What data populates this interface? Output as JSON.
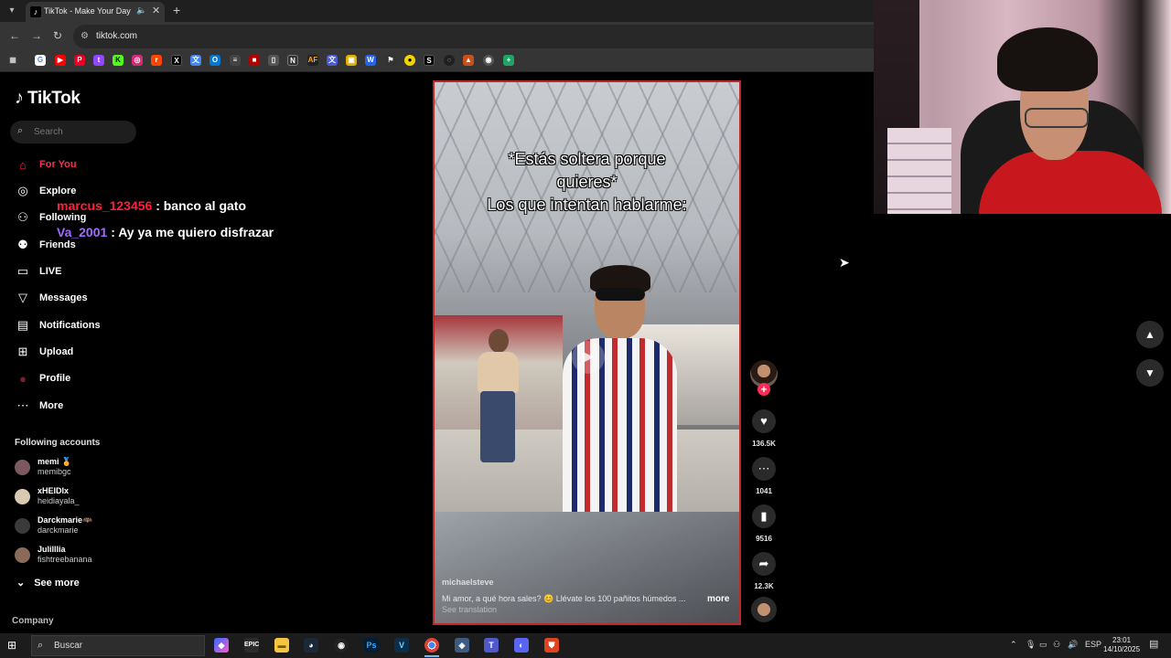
{
  "browser": {
    "tab_title": "TikTok - Make Your Day",
    "url": "tiktok.com",
    "tab_close": "✕",
    "new_tab": "+"
  },
  "tiktok": {
    "logo": "TikTok",
    "search_placeholder": "Search",
    "nav": [
      {
        "label": "For You",
        "icon": "home-icon",
        "active": true
      },
      {
        "label": "Explore",
        "icon": "compass-icon"
      },
      {
        "label": "Following",
        "icon": "following-icon"
      },
      {
        "label": "Friends",
        "icon": "friends-icon"
      },
      {
        "label": "LIVE",
        "icon": "live-icon"
      },
      {
        "label": "Messages",
        "icon": "messages-icon"
      },
      {
        "label": "Notifications",
        "icon": "notifications-icon"
      },
      {
        "label": "Upload",
        "icon": "upload-icon"
      },
      {
        "label": "Profile",
        "icon": "profile-icon"
      },
      {
        "label": "More",
        "icon": "more-icon"
      }
    ],
    "following_header": "Following accounts",
    "accounts": [
      {
        "name": "memi 🏅",
        "handle": "memibgc"
      },
      {
        "name": "xHEIDIx",
        "handle": "heidiayala_"
      },
      {
        "name": "Darckmarie🦇",
        "handle": "darckmarie"
      },
      {
        "name": "Julilllia",
        "handle": "fishtreebanana"
      }
    ],
    "see_more": "See more",
    "company": "Company"
  },
  "chat": [
    {
      "user": "marcus_123456",
      "message": ": banco al gato",
      "color": "#ff1f3c"
    },
    {
      "user": "Va_2001",
      "message": ": Ay ya me quiero disfrazar",
      "color": "#a26bff"
    }
  ],
  "video": {
    "caption_line1": "*Estás soltera porque",
    "caption_line2": "quieres*",
    "caption_line3": "Los que intentan hablarme:",
    "author": "michaelsteve",
    "description": "Mi amor, a qué hora sales? 😊 Llévate los 100 pañitos húmedos ...",
    "more": "more",
    "see_translation": "See translation",
    "likes": "136.5K",
    "comments": "1041",
    "saves": "9516",
    "shares": "12.3K"
  },
  "taskbar": {
    "search_placeholder": "Buscar",
    "lang": "ESP",
    "time": "23:01",
    "date": "14/10/2025"
  }
}
